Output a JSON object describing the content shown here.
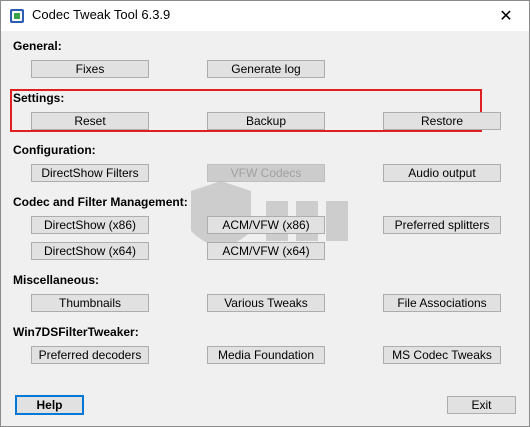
{
  "window": {
    "title": "Codec Tweak Tool 6.3.9",
    "close_symbol": "✕"
  },
  "sections": {
    "general": "General:",
    "settings": "Settings:",
    "configuration": "Configuration:",
    "codec_filter": "Codec and Filter Management:",
    "misc": "Miscellaneous:",
    "win7": "Win7DSFilterTweaker:"
  },
  "buttons": {
    "fixes": "Fixes",
    "generate_log": "Generate log",
    "reset": "Reset",
    "backup": "Backup",
    "restore": "Restore",
    "directshow_filters": "DirectShow Filters",
    "vfw_codecs": "VFW Codecs",
    "audio_output": "Audio output",
    "directshow_x86": "DirectShow  (x86)",
    "acm_vfw_x86": "ACM/VFW  (x86)",
    "preferred_splitters": "Preferred splitters",
    "directshow_x64": "DirectShow  (x64)",
    "acm_vfw_x64": "ACM/VFW  (x64)",
    "thumbnails": "Thumbnails",
    "various_tweaks": "Various Tweaks",
    "file_associations": "File Associations",
    "preferred_decoders": "Preferred decoders",
    "media_foundation": "Media Foundation",
    "ms_codec_tweaks": "MS Codec Tweaks",
    "help": "Help",
    "exit": "Exit"
  },
  "colors": {
    "highlight": "#e02020",
    "default_button_border": "#0078d7",
    "dialog_bg": "#f0f0f0"
  },
  "icons": {
    "app": "app-icon",
    "close": "close-icon",
    "watermark": "watermark-logo"
  }
}
